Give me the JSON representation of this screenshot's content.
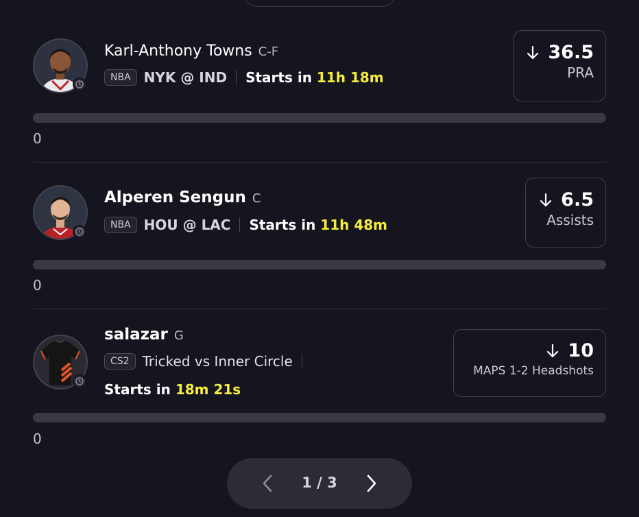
{
  "picks": [
    {
      "name": "Karl-Anthony Towns",
      "position": "C-F",
      "league": "NBA",
      "matchup": "NYK @ IND",
      "starts_prefix": "Starts in",
      "starts_time": "11h 18m",
      "line_value": "36.5",
      "line_stat": "PRA",
      "direction": "down",
      "count": "0",
      "avatar_icon": "player-headshot-icon"
    },
    {
      "name": "Alperen Sengun",
      "position": "C",
      "league": "NBA",
      "matchup": "HOU @ LAC",
      "starts_prefix": "Starts in",
      "starts_time": "11h 48m",
      "line_value": "6.5",
      "line_stat": "Assists",
      "direction": "down",
      "count": "0",
      "avatar_icon": "player-headshot-icon"
    },
    {
      "name": "salazar",
      "position": "G",
      "league": "CS2",
      "matchup": "Tricked vs Inner Circle",
      "starts_prefix": "Starts in",
      "starts_time": "18m 21s",
      "line_value": "10",
      "line_stat": "MAPS 1-2 Headshots",
      "direction": "down",
      "count": "0",
      "avatar_icon": "jersey-icon"
    }
  ],
  "pagination": {
    "label": "1 / 3",
    "current": 1,
    "total": 3,
    "prev_icon": "chevron-left-icon",
    "next_icon": "chevron-right-icon"
  },
  "colors": {
    "background": "#15151f",
    "highlight_time": "#f6ed3c",
    "progress_track": "#393943",
    "pager_bg": "#2c2c37"
  }
}
